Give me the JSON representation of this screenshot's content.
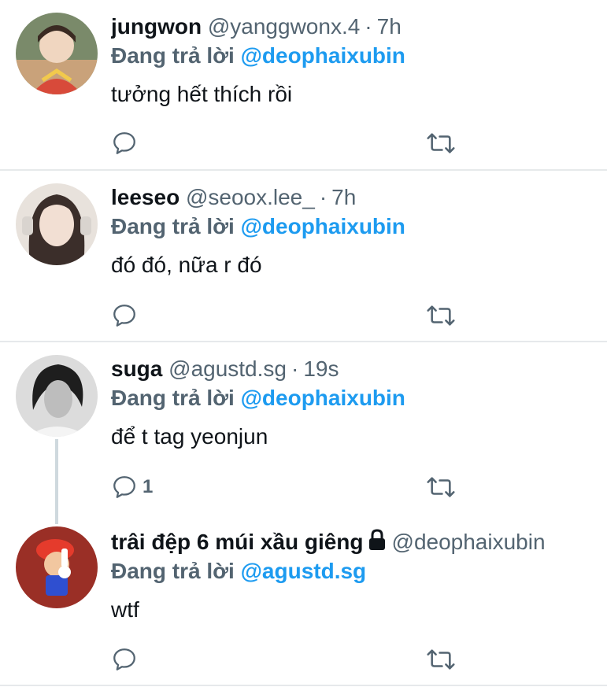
{
  "tweets": [
    {
      "name": "jungwon",
      "handle": "@yanggwonx.4",
      "time": "7h",
      "reply_label": "Đang trả lời",
      "reply_to": "@deophaixubin",
      "text": "tưởng hết thích rồi",
      "reply_count": "",
      "avatar_color": "#c9a27a"
    },
    {
      "name": "leeseo",
      "handle": "@seoox.lee_",
      "time": "7h",
      "reply_label": "Đang trả lời",
      "reply_to": "@deophaixubin",
      "text": "đó đó, nữa r đó",
      "reply_count": "",
      "avatar_color": "#6a5d58"
    },
    {
      "name": "suga",
      "handle": "@agustd.sg",
      "time": "19s",
      "reply_label": "Đang trả lời",
      "reply_to": "@deophaixubin",
      "text": "để t tag yeonjun",
      "reply_count": "1",
      "avatar_color": "#2a2a2a"
    },
    {
      "name": "trâi đệp 6 múi xầu giêng",
      "handle": "@deophaixubin",
      "time": "",
      "reply_label": "Đang trả lời",
      "reply_to": "@agustd.sg",
      "text": "wtf",
      "reply_count": "",
      "avatar_color": "#b5382e",
      "protected_icon": "lock-icon"
    }
  ],
  "colors": {
    "link_blue": "#1d9bf0",
    "muted_gray": "#536471",
    "separator": "#e6e9eb"
  },
  "icons": {
    "reply": "reply-bubble-icon",
    "retweet": "retweet-icon",
    "protected": "lock-icon"
  }
}
